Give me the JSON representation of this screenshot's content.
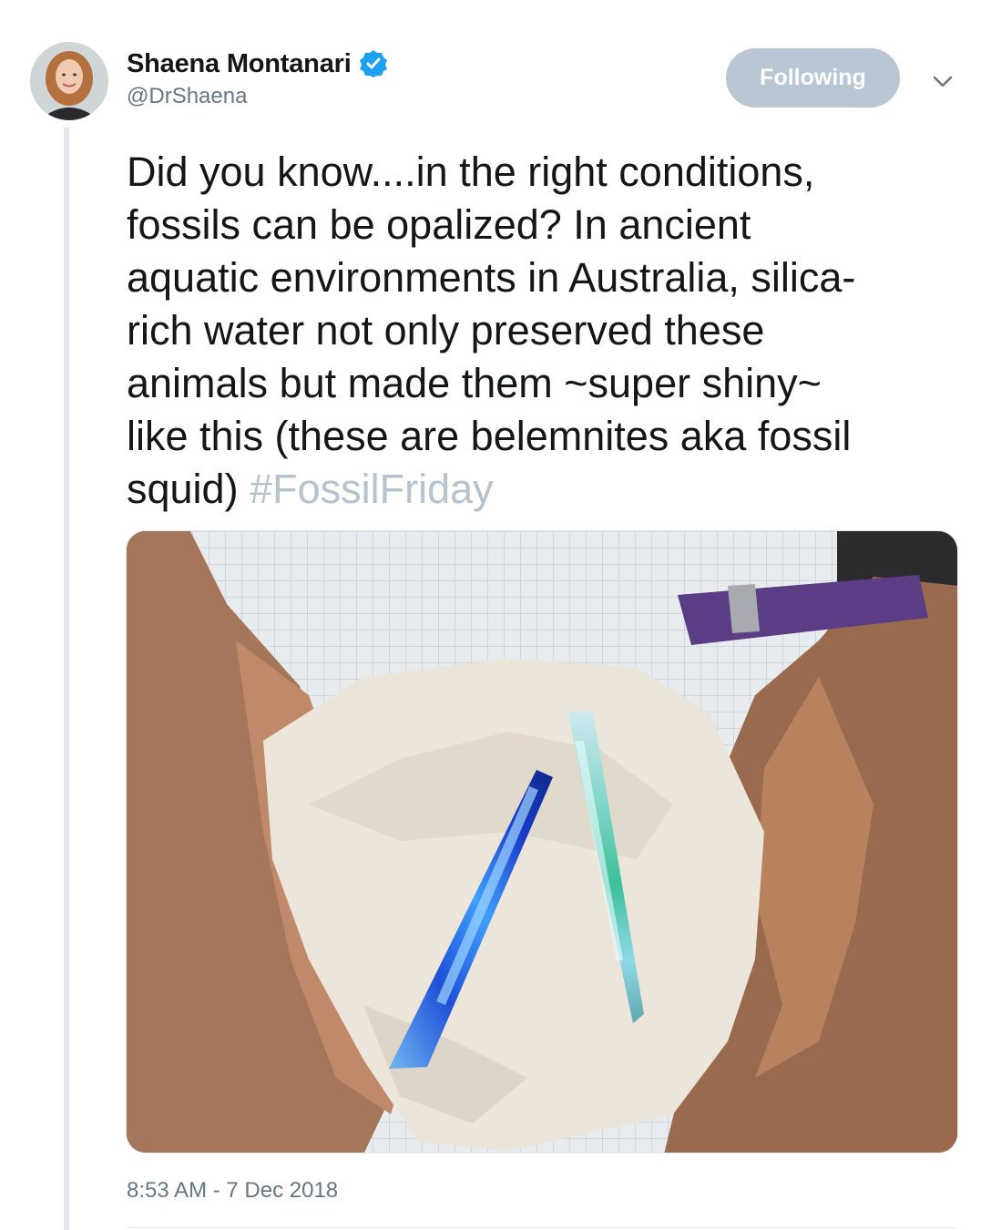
{
  "author": {
    "display_name": "Shaena Montanari",
    "handle": "@DrShaena",
    "verified": true,
    "avatar_icon": "profile-photo"
  },
  "follow_button": {
    "label": "Following",
    "color": "#b8c7d3"
  },
  "menu": {
    "icon": "chevron-down-icon"
  },
  "tweet": {
    "lines": [
      "Did you know....in the right conditions,",
      "fossils can be opalized? In ancient",
      "aquatic environments in Australia, silica-",
      "rich water not only preserved these",
      "animals but made them ~super shiny~",
      "like this (these are belemnites aka fossil"
    ],
    "last_line_text": "squid)",
    "hashtag": "#FossilFriday",
    "hashtag_color": "#b5c3cf"
  },
  "media": {
    "alt_icon": "photo-opalized-belemnites"
  },
  "timestamp": "8:53 AM - 7 Dec 2018",
  "colors": {
    "text": "#14171a",
    "secondary": "#657786",
    "verified_blue": "#1da1f2"
  }
}
